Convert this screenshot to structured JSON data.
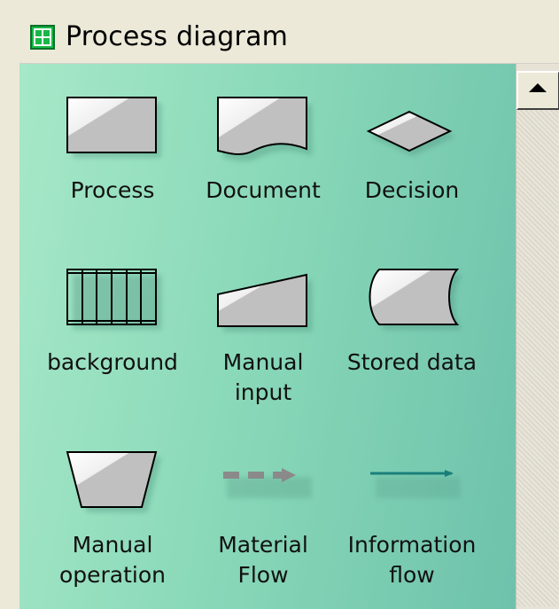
{
  "window": {
    "title": "Process diagram",
    "title_icon": "grid-icon"
  },
  "shapes": [
    {
      "label": "Process",
      "icon": "process-shape-icon"
    },
    {
      "label": "Document",
      "icon": "document-shape-icon"
    },
    {
      "label": "Decision",
      "icon": "decision-shape-icon"
    },
    {
      "label": "background",
      "icon": "background-shape-icon"
    },
    {
      "label": "Manual\ninput",
      "icon": "manual-input-shape-icon"
    },
    {
      "label": "Stored data",
      "icon": "stored-data-shape-icon"
    },
    {
      "label": "Manual\noperation",
      "icon": "manual-operation-shape-icon"
    },
    {
      "label": "Material\nFlow",
      "icon": "material-flow-shape-icon"
    },
    {
      "label": "Information\nflow",
      "icon": "information-flow-shape-icon"
    }
  ],
  "scrollbar": {
    "up_arrow_icon": "scroll-up-arrow-icon"
  },
  "colors": {
    "panel_gradient_start": "#a6e8c8",
    "panel_gradient_end": "#6ec2ab",
    "shape_fill": "#c0c0c0",
    "information_flow_line": "#1a7f7a"
  }
}
